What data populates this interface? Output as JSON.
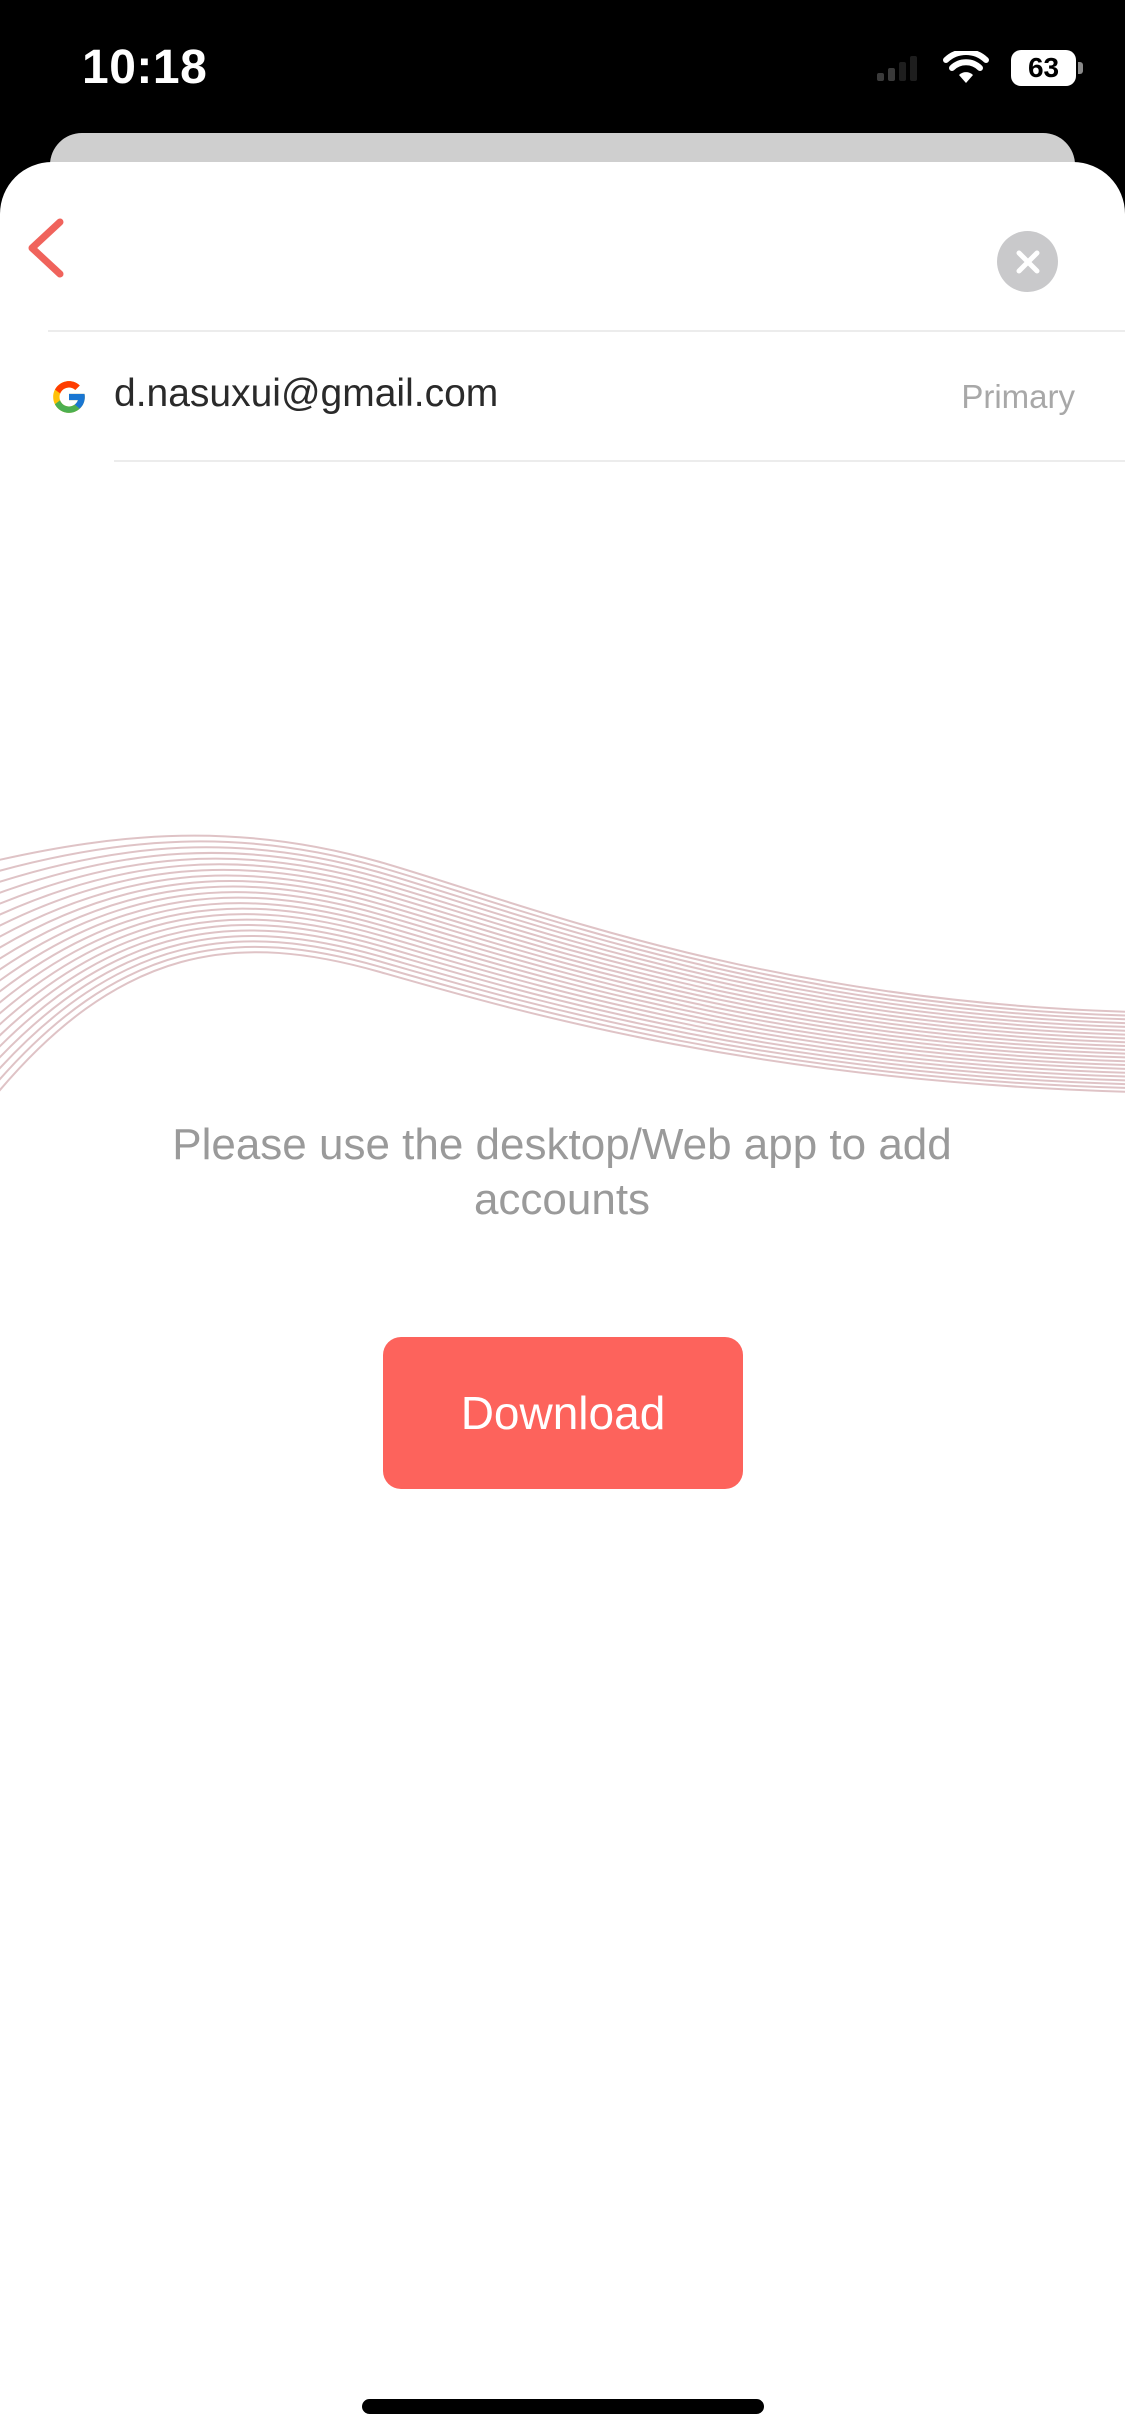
{
  "status_bar": {
    "time": "10:18",
    "battery_level": "63",
    "icons": [
      "cellular-signal-icon",
      "wifi-icon",
      "battery-icon"
    ]
  },
  "header": {
    "back_icon": "chevron-left-icon",
    "close_icon": "close-icon"
  },
  "account": {
    "provider_icon": "google-icon",
    "email": "d.nasuxui@gmail.com",
    "badge": "Primary"
  },
  "message": {
    "text": "Please use the desktop/Web app to add accounts"
  },
  "actions": {
    "download_label": "Download"
  },
  "colors": {
    "accent": "#fd635c",
    "back_chevron": "#f0635c",
    "wave_lines": "#d9b8bc",
    "muted_text": "#9a9a9a"
  }
}
